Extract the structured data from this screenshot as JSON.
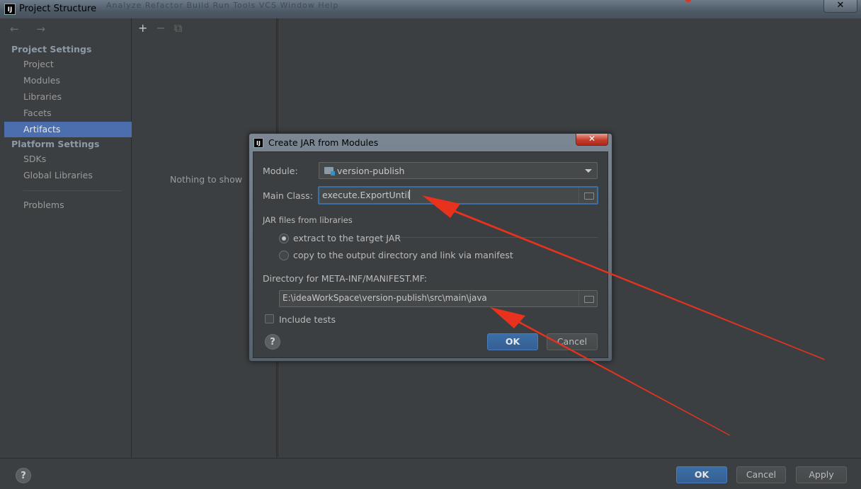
{
  "window": {
    "title": "Project Structure",
    "app_icon": "IJ",
    "background_menu": "Analyze  Refactor  Build  Run  Tools  VCS  Window  Help",
    "close_label": "✕"
  },
  "nav": {
    "back_forward": "← →",
    "project_settings": "Project Settings",
    "platform_settings": "Platform Settings",
    "items": [
      {
        "label": "Project"
      },
      {
        "label": "Modules"
      },
      {
        "label": "Libraries"
      },
      {
        "label": "Facets"
      },
      {
        "label": "Artifacts"
      },
      {
        "label": "SDKs"
      },
      {
        "label": "Global Libraries"
      },
      {
        "label": "Problems"
      }
    ],
    "selected": "Artifacts"
  },
  "middle": {
    "toolbar": {
      "add": "+",
      "remove": "−",
      "copy": "⧉"
    },
    "empty_text": "Nothing to show"
  },
  "bottom": {
    "help": "?",
    "ok": "OK",
    "cancel": "Cancel",
    "apply": "Apply"
  },
  "dialog": {
    "title": "Create JAR from Modules",
    "app_icon": "IJ",
    "close": "✕",
    "module_label": "Module:",
    "module_value": "version-publish",
    "main_class_label": "Main Class:",
    "main_class_value": "execute.ExportUntil",
    "jar_files_label": "JAR files from libraries",
    "radio_extract": "extract to the target JAR",
    "radio_copy": "copy to the output directory and link via manifest",
    "manifest_dir_label": "Directory for META-INF/MANIFEST.MF:",
    "manifest_dir_value": "E:\\ideaWorkSpace\\version-publish\\src\\main\\java",
    "include_tests": "Include tests",
    "help": "?",
    "ok": "OK",
    "cancel": "Cancel",
    "selected_radio": "extract"
  },
  "colors": {
    "annotation_arrow": "#e8321e",
    "selection": "#4b6eaf",
    "primary_button": "#365f92"
  }
}
